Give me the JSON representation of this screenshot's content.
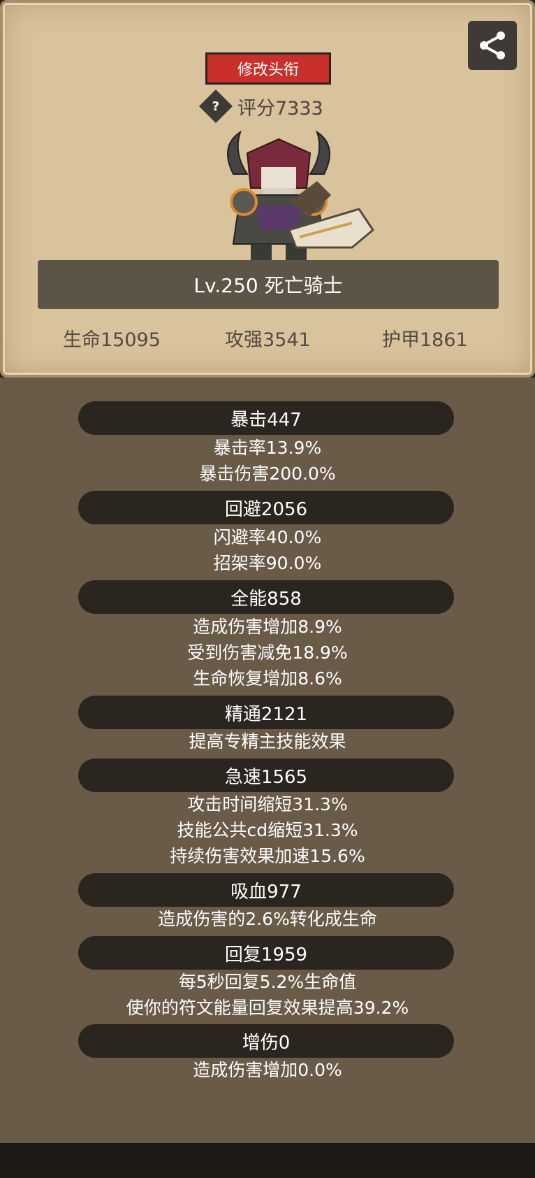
{
  "header": {
    "title_button": "修改头衔",
    "score": "评分7333",
    "help_symbol": "?",
    "level_name": "Lv.250 死亡骑士",
    "stats": [
      "生命15095",
      "攻强3541",
      "护甲1861"
    ]
  },
  "icons": {
    "share": "share-icon",
    "help": "question-icon"
  },
  "groups": [
    {
      "header": "暴击447",
      "lines": [
        "暴击率13.9%",
        "暴击伤害200.0%"
      ]
    },
    {
      "header": "回避2056",
      "lines": [
        "闪避率40.0%",
        "招架率90.0%"
      ]
    },
    {
      "header": "全能858",
      "lines": [
        "造成伤害增加8.9%",
        "受到伤害减免18.9%",
        "生命恢复增加8.6%"
      ]
    },
    {
      "header": "精通2121",
      "lines": [
        "提高专精主技能效果"
      ]
    },
    {
      "header": "急速1565",
      "lines": [
        "攻击时间缩短31.3%",
        "技能公共cd缩短31.3%",
        "持续伤害效果加速15.6%"
      ]
    },
    {
      "header": "吸血977",
      "lines": [
        "造成伤害的2.6%转化成生命"
      ]
    },
    {
      "header": "回复1959",
      "lines": [
        "每5秒回复5.2%生命值",
        "使你的符文能量回复效果提高39.2%"
      ]
    },
    {
      "header": "增伤0",
      "lines": [
        "造成伤害增加0.0%"
      ]
    }
  ],
  "colors": {
    "parchment": "#d8c39c",
    "panel": "#6a5a48",
    "banner": "#2b2520",
    "accent_red": "#c9302c"
  }
}
